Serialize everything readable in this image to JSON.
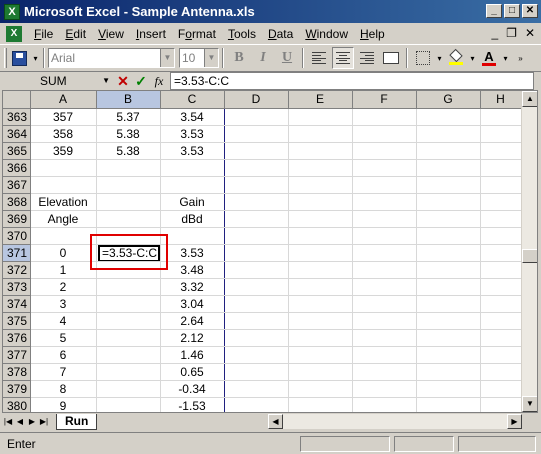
{
  "window": {
    "title": "Microsoft Excel - Sample Antenna.xls"
  },
  "menu": {
    "items": [
      {
        "label": "File",
        "key": "F"
      },
      {
        "label": "Edit",
        "key": "E"
      },
      {
        "label": "View",
        "key": "V"
      },
      {
        "label": "Insert",
        "key": "I"
      },
      {
        "label": "Format",
        "key": "o"
      },
      {
        "label": "Tools",
        "key": "T"
      },
      {
        "label": "Data",
        "key": "D"
      },
      {
        "label": "Window",
        "key": "W"
      },
      {
        "label": "Help",
        "key": "H"
      }
    ],
    "close_glyph": "✕"
  },
  "toolbar": {
    "font_name": "Arial",
    "font_size": "10",
    "bold": "B",
    "italic": "I",
    "underline": "U",
    "font_color_glyph": "A"
  },
  "formula_bar": {
    "name_box": "SUM",
    "cancel": "✕",
    "enter": "✓",
    "fx": "fx",
    "formula": "=3.53-C:C"
  },
  "grid": {
    "column_headers": [
      "A",
      "B",
      "C",
      "D",
      "E",
      "F",
      "G",
      "H"
    ],
    "rows": [
      {
        "num": "363",
        "A": "357",
        "B": "5.37",
        "C": "3.54"
      },
      {
        "num": "364",
        "A": "358",
        "B": "5.38",
        "C": "3.53"
      },
      {
        "num": "365",
        "A": "359",
        "B": "5.38",
        "C": "3.53"
      },
      {
        "num": "366",
        "A": "",
        "B": "",
        "C": ""
      },
      {
        "num": "367",
        "A": "",
        "B": "",
        "C": ""
      },
      {
        "num": "368",
        "A": "Elevation",
        "B": "",
        "C": "Gain"
      },
      {
        "num": "369",
        "A": "Angle",
        "B": "",
        "C": "dBd"
      },
      {
        "num": "370",
        "A": "",
        "B": "",
        "C": ""
      },
      {
        "num": "371",
        "A": "0",
        "B": "=3.53-C:C",
        "C": "3.53"
      },
      {
        "num": "372",
        "A": "1",
        "B": "",
        "C": "3.48"
      },
      {
        "num": "373",
        "A": "2",
        "B": "",
        "C": "3.32"
      },
      {
        "num": "374",
        "A": "3",
        "B": "",
        "C": "3.04"
      },
      {
        "num": "375",
        "A": "4",
        "B": "",
        "C": "2.64"
      },
      {
        "num": "376",
        "A": "5",
        "B": "",
        "C": "2.12"
      },
      {
        "num": "377",
        "A": "6",
        "B": "",
        "C": "1.46"
      },
      {
        "num": "378",
        "A": "7",
        "B": "",
        "C": "0.65"
      },
      {
        "num": "379",
        "A": "8",
        "B": "",
        "C": "-0.34"
      },
      {
        "num": "380",
        "A": "9",
        "B": "",
        "C": "-1.53"
      }
    ],
    "active_cell": {
      "row": "371",
      "col": "B"
    }
  },
  "sheets": [
    {
      "label": "Run",
      "active": true
    }
  ],
  "status": {
    "mode": "Enter"
  },
  "colors": {
    "title_start": "#0a246a",
    "title_end": "#3a6ea5",
    "highlight": "#e00000",
    "chrome": "#d4d0c8"
  }
}
